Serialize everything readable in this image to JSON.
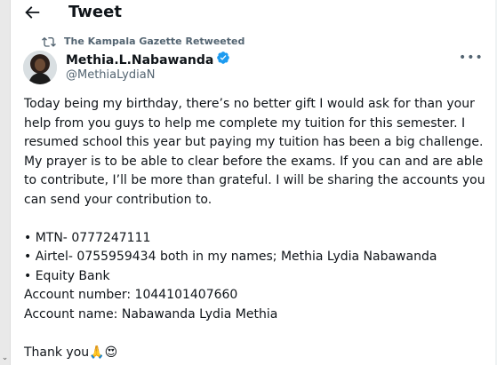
{
  "header": {
    "title": "Tweet"
  },
  "retweet": {
    "label": "The Kampala Gazette Retweeted"
  },
  "author": {
    "name": "Methia.L.Nabawanda",
    "handle": "@MethiaLydiaN"
  },
  "colors": {
    "verified": "#1d9bf0",
    "secondary_text": "#536471",
    "text": "#0f1419"
  },
  "tweet": {
    "paragraph": "Today being my birthday, there’s no better gift I would ask for than your help from you guys to help me complete my tuition for this semester. I resumed school this year but paying my tuition has been a big challenge. My prayer is to be able to clear before the exams. If you can and are able to contribute, I’ll be more than grateful. I will be sharing the accounts you can send your contribution to.",
    "line_mtn": "• MTN- 0777247111",
    "line_airtel": "• Airtel- 0755959434 both in my names; Methia Lydia Nabawanda",
    "line_bank": "• Equity Bank",
    "account_number": "Account number: 1044101407660",
    "account_name": "Account name: Nabawanda Lydia Methia",
    "thanks": "Thank you",
    "emojis": "🙏😍"
  }
}
